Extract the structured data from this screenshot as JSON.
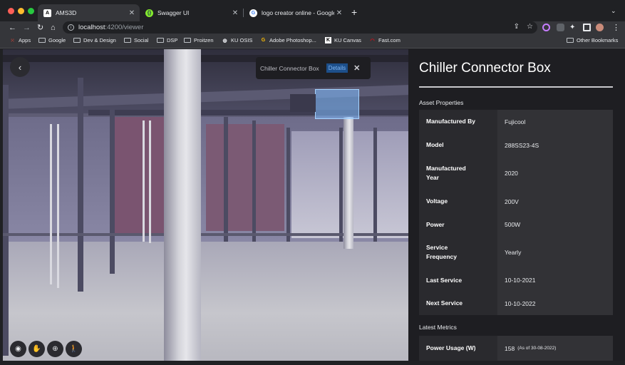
{
  "browser": {
    "tabs": [
      {
        "title": "AMS3D",
        "icon": "A"
      },
      {
        "title": "Swagger UI",
        "icon": "swagger"
      },
      {
        "title": "logo creator online - Google Se",
        "icon": "G"
      }
    ],
    "url_host": "localhost",
    "url_path": ":4200/viewer",
    "bookmarks": [
      {
        "label": "Apps"
      },
      {
        "label": "Google"
      },
      {
        "label": "Dev & Design"
      },
      {
        "label": "Social"
      },
      {
        "label": "DSP"
      },
      {
        "label": "Proitzen"
      },
      {
        "label": "KU OSIS"
      },
      {
        "label": "Adobe Photoshop..."
      },
      {
        "label": "KU Canvas"
      },
      {
        "label": "Fast.com"
      }
    ],
    "other_bookmarks": "Other Bookmarks"
  },
  "viewer": {
    "popup": {
      "title": "Chiller Connector Box",
      "details_label": "Details",
      "close_label": "✕"
    }
  },
  "panel": {
    "title": "Chiller Connector Box",
    "asset_section": "Asset Properties",
    "properties": [
      {
        "key": "Manufactured By",
        "value": "Fujicool"
      },
      {
        "key": "Model",
        "value": "288SS23-4S"
      },
      {
        "key": "Manufactured Year",
        "value": "2020"
      },
      {
        "key": "Voltage",
        "value": "200V"
      },
      {
        "key": "Power",
        "value": "500W"
      },
      {
        "key": "Service Frequency",
        "value": "Yearly"
      },
      {
        "key": "Last Service",
        "value": "10-10-2021"
      },
      {
        "key": "Next Service",
        "value": "10-10-2022"
      }
    ],
    "metrics_section": "Latest Metrics",
    "metrics": [
      {
        "key": "Power Usage (W)",
        "value": "158",
        "note": "(As of 30-08-2022)"
      }
    ]
  }
}
